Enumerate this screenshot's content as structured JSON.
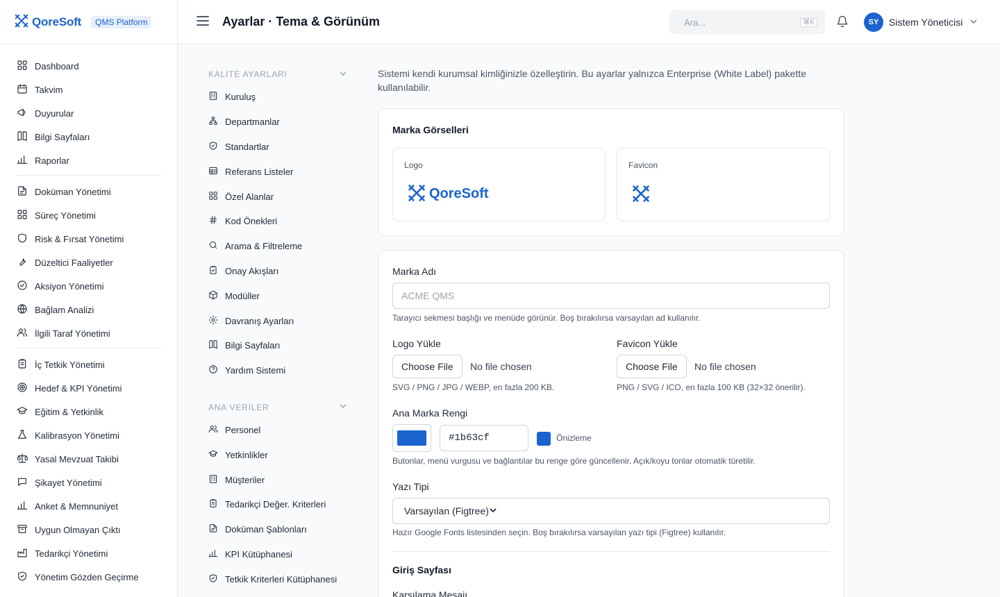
{
  "brand": {
    "name": "QoreSoft",
    "badge": "QMS Platform"
  },
  "header": {
    "title": "Ayarlar · Tema & Görünüm",
    "search_placeholder": "Ara...",
    "search_shortcut": "⌘K",
    "user_initials": "SY",
    "user_name": "Sistem Yöneticisi"
  },
  "sidebar": {
    "groups": [
      [
        {
          "label": "Dashboard",
          "icon": "grid-icon"
        },
        {
          "label": "Takvim",
          "icon": "calendar-icon"
        },
        {
          "label": "Duyurular",
          "icon": "megaphone-icon"
        },
        {
          "label": "Bilgi Sayfaları",
          "icon": "book-icon"
        },
        {
          "label": "Raporlar",
          "icon": "bar-chart-icon"
        }
      ],
      [
        {
          "label": "Doküman Yönetimi",
          "icon": "document-icon"
        },
        {
          "label": "Süreç Yönetimi",
          "icon": "grid-icon"
        },
        {
          "label": "Risk & Fırsat Yönetimi",
          "icon": "shield-icon"
        },
        {
          "label": "Düzeltici Faaliyetler",
          "icon": "wrench-icon"
        },
        {
          "label": "Aksiyon Yönetimi",
          "icon": "check-circle-icon"
        },
        {
          "label": "Bağlam Analizi",
          "icon": "globe-icon"
        },
        {
          "label": "İlgili Taraf Yönetimi",
          "icon": "users-icon"
        }
      ],
      [
        {
          "label": "İç Tetkik Yönetimi",
          "icon": "clipboard-icon"
        },
        {
          "label": "Hedef & KPI Yönetimi",
          "icon": "target-icon"
        },
        {
          "label": "Eğitim & Yetkinlik",
          "icon": "graduation-cap-icon"
        },
        {
          "label": "Kalibrasyon Yönetimi",
          "icon": "flask-icon"
        },
        {
          "label": "Yasal Mevzuat Takibi",
          "icon": "scale-icon"
        },
        {
          "label": "Şikayet Yönetimi",
          "icon": "chat-icon"
        },
        {
          "label": "Anket & Memnuniyet",
          "icon": "bar-chart-icon"
        },
        {
          "label": "Uygun Olmayan Çıktı",
          "icon": "archive-icon"
        },
        {
          "label": "Tedarikçi Yönetimi",
          "icon": "factory-icon"
        },
        {
          "label": "Yönetim Gözden Geçirme",
          "icon": "shield-check-icon"
        }
      ]
    ]
  },
  "subnav": {
    "sections": [
      {
        "title": "KALİTE AYARLARI",
        "items": [
          {
            "label": "Kuruluş",
            "icon": "building-icon"
          },
          {
            "label": "Departmanlar",
            "icon": "sitemap-icon"
          },
          {
            "label": "Standartlar",
            "icon": "shield-check-icon"
          },
          {
            "label": "Referans Listeler",
            "icon": "table-icon"
          },
          {
            "label": "Özel Alanlar",
            "icon": "grid-icon"
          },
          {
            "label": "Kod Önekleri",
            "icon": "hash-icon"
          },
          {
            "label": "Arama & Filtreleme",
            "icon": "search-icon"
          },
          {
            "label": "Onay Akışları",
            "icon": "clipboard-check-icon"
          },
          {
            "label": "Modüller",
            "icon": "cube-icon"
          },
          {
            "label": "Davranış Ayarları",
            "icon": "gear-icon"
          },
          {
            "label": "Bilgi Sayfaları",
            "icon": "book-icon"
          },
          {
            "label": "Yardım Sistemi",
            "icon": "help-circle-icon"
          }
        ]
      },
      {
        "title": "ANA VERİLER",
        "items": [
          {
            "label": "Personel",
            "icon": "users-icon"
          },
          {
            "label": "Yetkinlikler",
            "icon": "graduation-cap-icon"
          },
          {
            "label": "Müşteriler",
            "icon": "building-icon"
          },
          {
            "label": "Tedarikçi Değer. Kriterleri",
            "icon": "clipboard-icon"
          },
          {
            "label": "Doküman Şablonları",
            "icon": "document-icon"
          },
          {
            "label": "KPI Kütüphanesi",
            "icon": "bar-chart-icon"
          },
          {
            "label": "Tetkik Kriterleri Kütüphanesi",
            "icon": "shield-check-icon"
          }
        ]
      }
    ]
  },
  "main": {
    "intro": "Sistemi kendi kurumsal kimliğinizle özelleştirin. Bu ayarlar yalnızca Enterprise (White Label) pakette kullanılabilir.",
    "brand_assets": {
      "title": "Marka Görselleri",
      "logo_label": "Logo",
      "logo_text": "QoreSoft",
      "favicon_label": "Favicon"
    },
    "form": {
      "brand_name_label": "Marka Adı",
      "brand_name_placeholder": "ACME QMS",
      "brand_name_value": "",
      "brand_name_help": "Tarayıcı sekmesi başlığı ve menüde görünür. Boş bırakılırsa varsayılan ad kullanılır.",
      "logo_upload_label": "Logo Yükle",
      "logo_upload_button": "Choose File",
      "logo_upload_status": "No file chosen",
      "logo_upload_help": "SVG / PNG / JPG / WEBP, en fazla 200 KB.",
      "favicon_upload_label": "Favicon Yükle",
      "favicon_upload_button": "Choose File",
      "favicon_upload_status": "No file chosen",
      "favicon_upload_help": "PNG / SVG / ICO, en fazla 100 KB (32×32 önerilir).",
      "color_label": "Ana Marka Rengi",
      "color_value": "#1b63cf",
      "color_preview_label": "Önizleme",
      "color_help": "Butonlar, menü vurgusu ve bağlantılar bu renge göre güncellenir. Açık/koyu tonlar otomatik türetilir.",
      "font_label": "Yazı Tipi",
      "font_selected": "Varsayılan (Figtree)",
      "font_help": "Hazır Google Fonts listesinden seçin. Boş bırakılırsa varsayılan yazı tipi (Figtree) kullanılır.",
      "login_section_title": "Giriş Sayfası",
      "welcome_label": "Karşılama Mesajı"
    }
  },
  "colors": {
    "accent": "#1b63cf",
    "text": "#1f2937",
    "muted": "#6b7280",
    "border": "#e5e7eb"
  }
}
